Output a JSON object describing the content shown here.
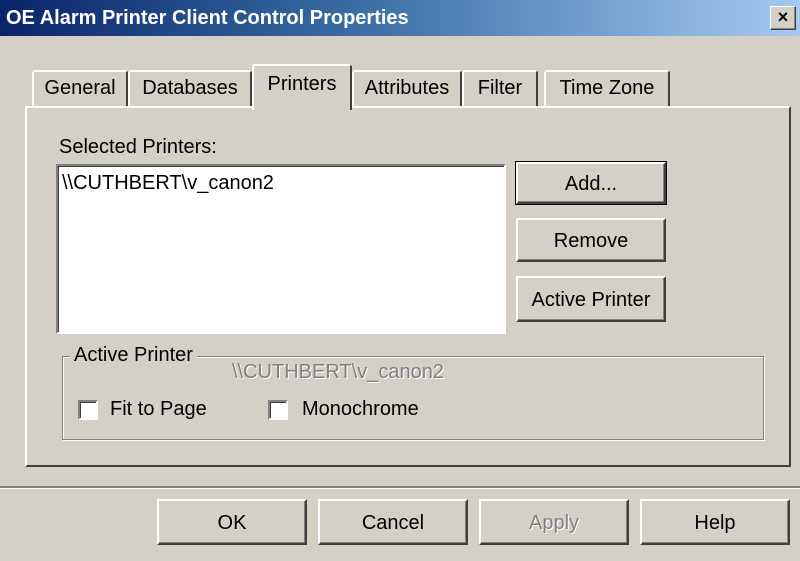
{
  "window": {
    "title": "OE Alarm Printer Client Control Properties",
    "close_symbol": "×"
  },
  "tabs": [
    {
      "label": "General",
      "active": false
    },
    {
      "label": "Databases",
      "active": false
    },
    {
      "label": "Printers",
      "active": true
    },
    {
      "label": "Attributes",
      "active": false
    },
    {
      "label": "Filter",
      "active": false
    },
    {
      "label": "Time Zone",
      "active": false
    }
  ],
  "printers_tab": {
    "selected_printers_label": "Selected Printers:",
    "selected_printers": [
      "\\\\CUTHBERT\\v_canon2"
    ],
    "add_button": "Add...",
    "remove_button": "Remove",
    "active_printer_button": "Active Printer",
    "active_printer_group": {
      "label": "Active Printer",
      "value": "\\\\CUTHBERT\\v_canon2",
      "fit_to_page_label": "Fit to Page",
      "fit_to_page_checked": false,
      "monochrome_label": "Monochrome",
      "monochrome_checked": false
    }
  },
  "dialog_buttons": {
    "ok": "OK",
    "cancel": "Cancel",
    "apply": "Apply",
    "apply_enabled": false,
    "help": "Help"
  }
}
